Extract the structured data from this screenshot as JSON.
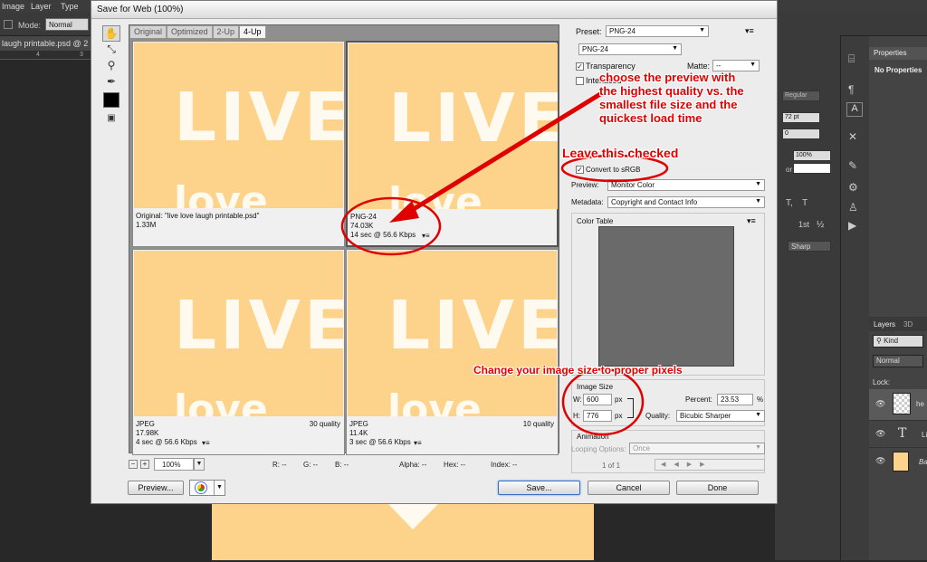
{
  "menubar": {
    "items": [
      "Image",
      "Layer",
      "Type"
    ]
  },
  "options_bar": {
    "mode_label": "Mode:",
    "mode_value": "Normal"
  },
  "document": {
    "tab_title": "laugh printable.psd @ 2",
    "ruler_marks": [
      "4",
      "3"
    ]
  },
  "dialog": {
    "title": "Save for Web (100%)",
    "tabs": [
      "Original",
      "Optimized",
      "2-Up",
      "4-Up"
    ],
    "previews": [
      {
        "line1": "Original: \"live love laugh printable.psd\"",
        "line2": "1.33M",
        "line3": "",
        "quality": ""
      },
      {
        "line1": "PNG-24",
        "line2": "74.03K",
        "line3": "14 sec @ 56.6 Kbps",
        "quality": ""
      },
      {
        "line1": "JPEG",
        "line2": "17.98K",
        "line3": "4 sec @ 56.6 Kbps",
        "quality": "30 quality"
      },
      {
        "line1": "JPEG",
        "line2": "11.4K",
        "line3": "3 sec @ 56.6 Kbps",
        "quality": "10 quality"
      }
    ],
    "artwork": {
      "line1": "LIVE",
      "line2": "love"
    },
    "zoom": "100%",
    "readouts": {
      "r": "R: --",
      "g": "G: --",
      "b": "B: --",
      "alpha": "Alpha: --",
      "hex": "Hex: --",
      "index": "Index: --"
    },
    "buttons": {
      "preview": "Preview...",
      "save": "Save...",
      "cancel": "Cancel",
      "done": "Done"
    },
    "settings": {
      "preset_label": "Preset:",
      "preset_value": "PNG-24",
      "format_value": "PNG-24",
      "transparency_label": "Transparency",
      "interlaced_label": "Interlaced",
      "matte_label": "Matte:",
      "matte_value": "--",
      "convert_label": "Convert to sRGB",
      "preview_label": "Preview:",
      "preview_value": "Monitor Color",
      "metadata_label": "Metadata:",
      "metadata_value": "Copyright and Contact Info",
      "color_table_label": "Color Table",
      "image_size_label": "Image Size",
      "w_label": "W:",
      "w_value": "600",
      "h_label": "H:",
      "h_value": "776",
      "unit": "px",
      "percent_label": "Percent:",
      "percent_value": "23.53",
      "percent_unit": "%",
      "quality_label": "Quality:",
      "quality_value": "Bicubic Sharper",
      "animation_label": "Animation",
      "looping_label": "Looping Options:",
      "looping_value": "Once",
      "frame_counter": "1 of 1"
    }
  },
  "annotations": {
    "quality_note": [
      "choose the preview with",
      "the highest quality vs. the",
      "smallest file size and the",
      "quickest load time"
    ],
    "checked_note": "Leave this checked",
    "size_note": "Change your image size to proper pixels",
    "accent": "#e00000"
  },
  "character_panel": {
    "style": "Regular",
    "size": "72 pt",
    "tracking": "0",
    "scale": "100%",
    "color_label": "or:",
    "antialias": "Sharp",
    "fractions": [
      "T,",
      "T",
      "1st",
      "½"
    ]
  },
  "properties_panel": {
    "title": "Properties",
    "empty_text": "No Properties"
  },
  "layers_panel": {
    "tabs": [
      "Layers",
      "3D"
    ],
    "filter_value": "Kind",
    "blend_value": "Normal",
    "lock_label": "Lock:",
    "layers": [
      {
        "name": "he"
      },
      {
        "name": "Li"
      },
      {
        "name": "Ba"
      }
    ]
  }
}
